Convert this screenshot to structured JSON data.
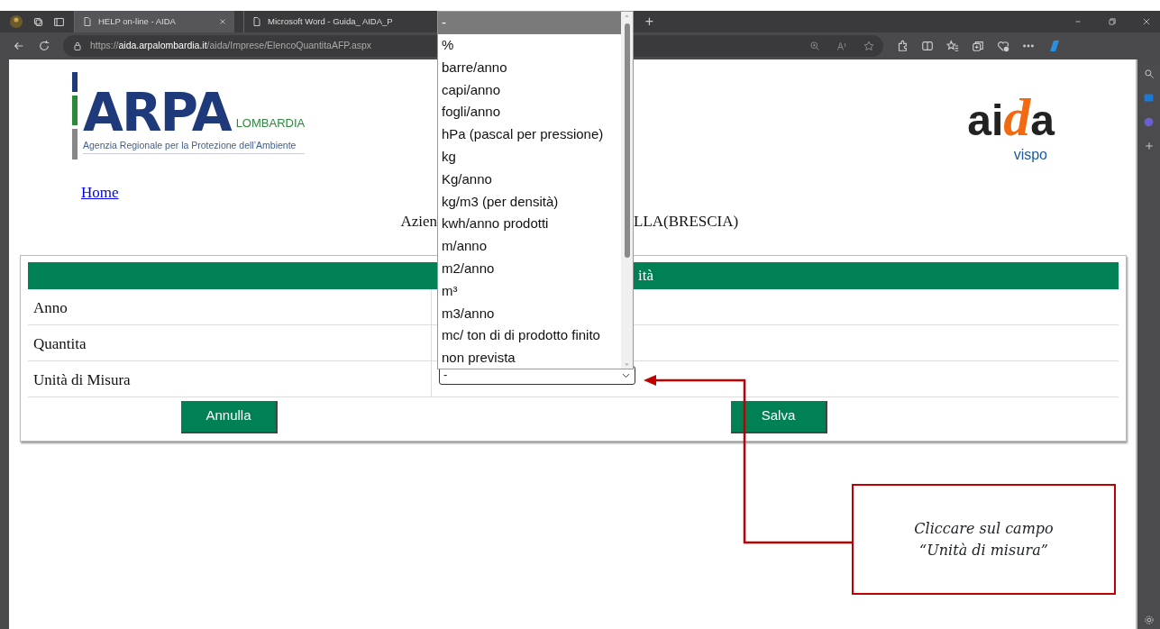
{
  "browser": {
    "tabs": [
      {
        "title": "HELP on-line - AIDA",
        "selected": true
      },
      {
        "title": "Microsoft Word - Guida_ AIDA_P",
        "selected": false
      }
    ],
    "new_tab": "+",
    "url": {
      "scheme": "https://",
      "host": "aida.arpalombardia.it",
      "path": "/aida/Imprese/ElencoQuantitaAFP.aspx"
    }
  },
  "page": {
    "logo": {
      "name": "ARPA",
      "region": "LOMBARDIA",
      "tagline": "Agenzia Regionale per la Protezione dell’Ambiente"
    },
    "aida_logo": {
      "letters": [
        "ai",
        "d",
        "a"
      ],
      "sub": "vispo"
    },
    "home_link": "Home",
    "company": {
      "before": "Azien",
      "after": "LLA(BRESCIA)"
    },
    "form": {
      "header": "ità",
      "rows": [
        {
          "label": "Anno",
          "kind": "text"
        },
        {
          "label": "Quantita",
          "kind": "text"
        },
        {
          "label": "Unità di Misura",
          "kind": "select",
          "value": "-"
        }
      ],
      "buttons": [
        "Annulla",
        "Salva"
      ]
    }
  },
  "dropdown": {
    "options": [
      {
        "label": "-",
        "selected": true
      },
      {
        "label": "%",
        "selected": false
      },
      {
        "label": "barre/anno",
        "selected": false
      },
      {
        "label": "capi/anno",
        "selected": false
      },
      {
        "label": "fogli/anno",
        "selected": false
      },
      {
        "label": "hPa (pascal per pressione)",
        "selected": false
      },
      {
        "label": "kg",
        "selected": false
      },
      {
        "label": "Kg/anno",
        "selected": false
      },
      {
        "label": "kg/m3 (per densità)",
        "selected": false
      },
      {
        "label": "kwh/anno prodotti",
        "selected": false
      },
      {
        "label": "m/anno",
        "selected": false
      },
      {
        "label": "m2/anno",
        "selected": false
      },
      {
        "label": "m³",
        "selected": false
      },
      {
        "label": "m3/anno",
        "selected": false
      },
      {
        "label": "mc/ ton di di prodotto finito",
        "selected": false
      },
      {
        "label": "non prevista",
        "selected": false
      }
    ]
  },
  "callout": {
    "lines": [
      "Cliccare sul campo",
      "“Unità di misura”"
    ]
  }
}
